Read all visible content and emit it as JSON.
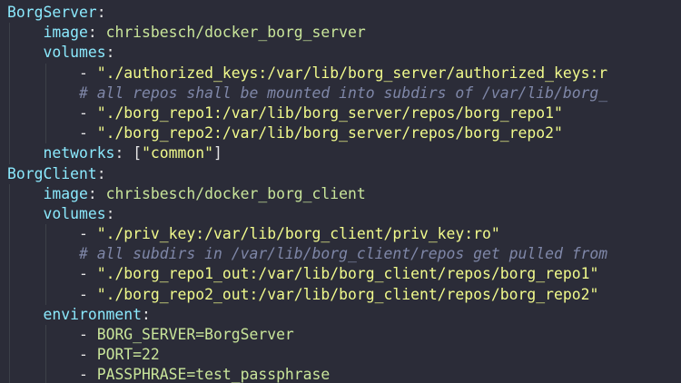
{
  "colors": {
    "background": "#2b2c38",
    "key": "#8be9fd",
    "string": "#f1fa8c",
    "value": "#c9e59a",
    "comment": "#7f87a8",
    "punctuation": "#e6e6e6",
    "indent_guide": "#3c4048"
  },
  "lines": [
    {
      "indent": 0,
      "key": "BorgServer",
      "sep": ":"
    },
    {
      "indent": 1,
      "key": "image",
      "sep": ": ",
      "value": "chrisbesch/docker_borg_server"
    },
    {
      "indent": 1,
      "key": "volumes",
      "sep": ":"
    },
    {
      "indent": 2,
      "dash": "- ",
      "string": "\"./authorized_keys:/var/lib/borg_server/authorized_keys:r"
    },
    {
      "indent": 2,
      "comment": "# all repos shall be mounted into subdirs of /var/lib/borg_"
    },
    {
      "indent": 2,
      "dash": "- ",
      "string": "\"./borg_repo1:/var/lib/borg_server/repos/borg_repo1\""
    },
    {
      "indent": 2,
      "dash": "- ",
      "string": "\"./borg_repo2:/var/lib/borg_server/repos/borg_repo2\""
    },
    {
      "indent": 1,
      "key": "networks",
      "sep": ": ",
      "bracket_open": "[",
      "string": "\"common\"",
      "bracket_close": "]"
    },
    {
      "indent": 0,
      "key": "BorgClient",
      "sep": ":"
    },
    {
      "indent": 1,
      "key": "image",
      "sep": ": ",
      "value": "chrisbesch/docker_borg_client"
    },
    {
      "indent": 1,
      "key": "volumes",
      "sep": ":"
    },
    {
      "indent": 2,
      "dash": "- ",
      "string": "\"./priv_key:/var/lib/borg_client/priv_key:ro\""
    },
    {
      "indent": 2,
      "comment": "# all subdirs in /var/lib/borg_client/repos get pulled from"
    },
    {
      "indent": 2,
      "dash": "- ",
      "string": "\"./borg_repo1_out:/var/lib/borg_client/repos/borg_repo1\""
    },
    {
      "indent": 2,
      "dash": "- ",
      "string": "\"./borg_repo2_out:/var/lib/borg_client/repos/borg_repo2\""
    },
    {
      "indent": 1,
      "key": "environment",
      "sep": ":"
    },
    {
      "indent": 2,
      "dash": "- ",
      "value": "BORG_SERVER=BorgServer"
    },
    {
      "indent": 2,
      "dash": "- ",
      "value": "PORT=22"
    },
    {
      "indent": 2,
      "dash": "- ",
      "value": "PASSPHRASE=test_passphrase"
    }
  ]
}
